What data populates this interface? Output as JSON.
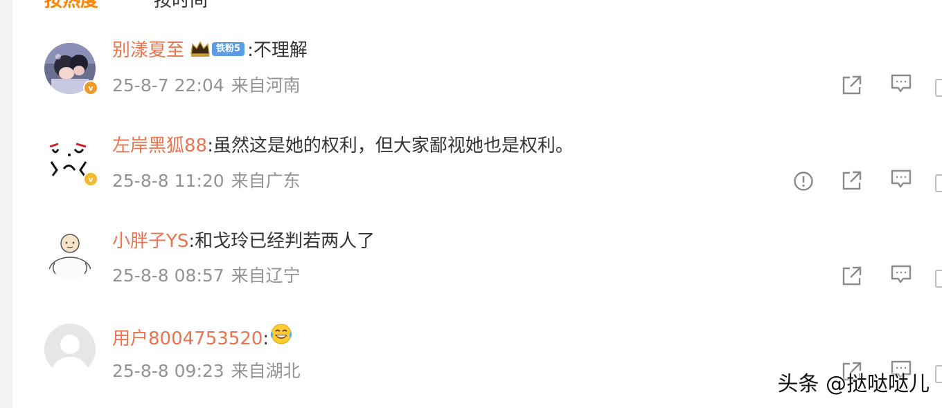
{
  "tabs": {
    "hot": "按热度",
    "time": "按时间"
  },
  "comments": [
    {
      "username": "别漾夏至",
      "fan_badge": "铁粉5",
      "text": ":不理解",
      "timestamp": "25-8-7 22:04",
      "location": "来自河南",
      "badge_color": "#f09a2b",
      "actions": [
        "share-icon",
        "comment-icon"
      ]
    },
    {
      "username": "左岸黑狐88",
      "text": ":虽然这是她的权利，但大家鄙视她也是权利。",
      "timestamp": "25-8-8 11:20",
      "location": "来自广东",
      "badge_color": "#f5b82e",
      "actions": [
        "report-icon",
        "share-icon",
        "comment-icon"
      ]
    },
    {
      "username": "小胖子YS",
      "text": ":和戈玲已经判若两人了",
      "timestamp": "25-8-8 08:57",
      "location": "来自辽宁",
      "actions": [
        "share-icon",
        "comment-icon"
      ]
    },
    {
      "username": "用户8004753520",
      "text": ":",
      "emoji": "laughing-tears-emoji",
      "timestamp": "25-8-8 09:23",
      "location": "来自湖北",
      "actions": [
        "share-icon",
        "comment-icon"
      ]
    }
  ],
  "watermark": "头条 @挞哒哒儿",
  "colors": {
    "username": "#eb7350",
    "meta": "#939393",
    "text": "#333333",
    "accent": "#ff8200",
    "icon": "#8a8a8a"
  }
}
